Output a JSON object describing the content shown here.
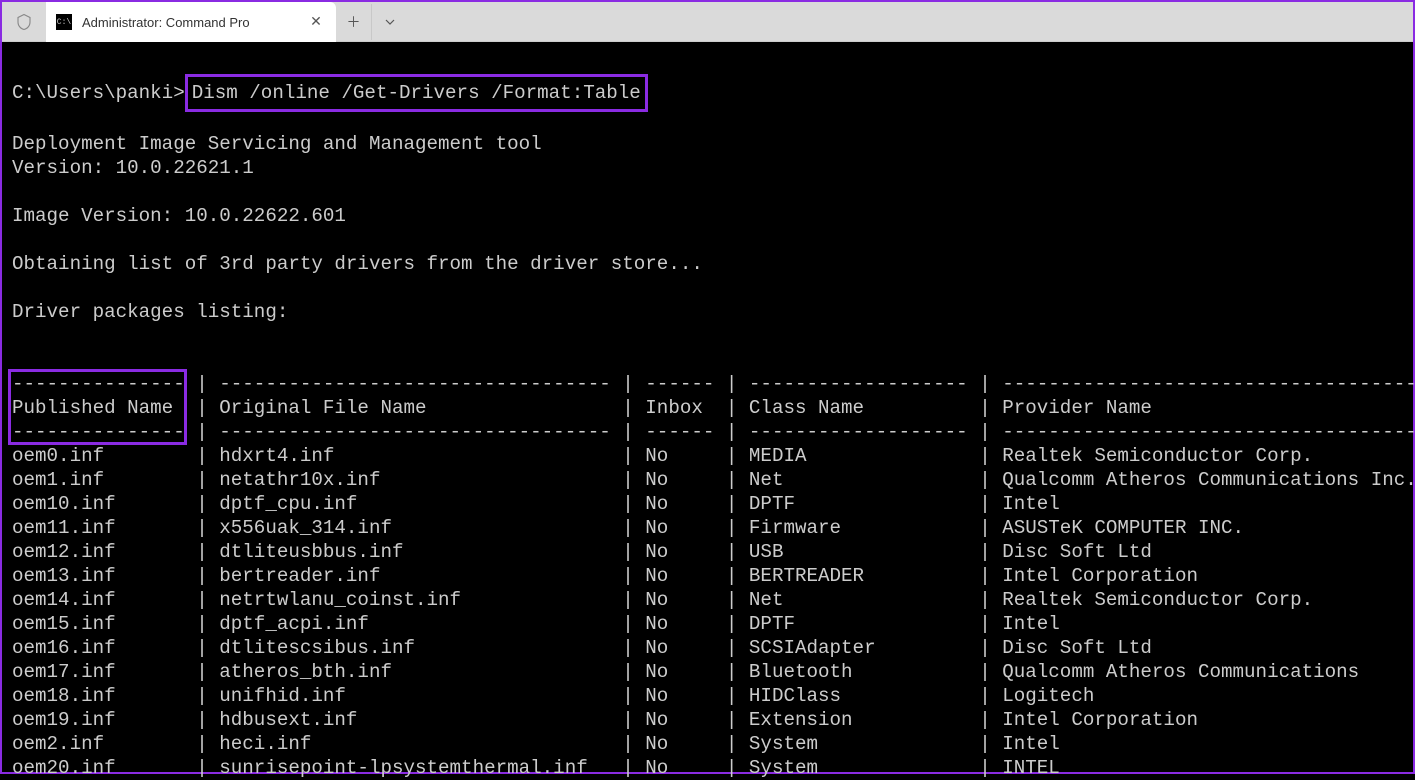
{
  "window": {
    "tab_title": "Administrator: Command Pro"
  },
  "terminal": {
    "prompt_path": "C:\\Users\\panki>",
    "command": "Dism /online /Get-Drivers /Format:Table",
    "tool_header": "Deployment Image Servicing and Management tool",
    "tool_version": "Version: 10.0.22621.1",
    "image_version": "Image Version: 10.0.22622.601",
    "obtaining": "Obtaining list of 3rd party drivers from the driver store...",
    "listing": "Driver packages listing:",
    "headers": {
      "published": "Published Name",
      "original": "Original File Name",
      "inbox": "Inbox",
      "class": "Class Name",
      "provider": "Provider Name"
    },
    "rows": [
      {
        "pub": "oem0.inf",
        "orig": "hdxrt4.inf",
        "inbox": "No",
        "class": "MEDIA",
        "prov": "Realtek Semiconductor Corp."
      },
      {
        "pub": "oem1.inf",
        "orig": "netathr10x.inf",
        "inbox": "No",
        "class": "Net",
        "prov": "Qualcomm Atheros Communications Inc."
      },
      {
        "pub": "oem10.inf",
        "orig": "dptf_cpu.inf",
        "inbox": "No",
        "class": "DPTF",
        "prov": "Intel"
      },
      {
        "pub": "oem11.inf",
        "orig": "x556uak_314.inf",
        "inbox": "No",
        "class": "Firmware",
        "prov": "ASUSTeK COMPUTER INC."
      },
      {
        "pub": "oem12.inf",
        "orig": "dtliteusbbus.inf",
        "inbox": "No",
        "class": "USB",
        "prov": "Disc Soft Ltd"
      },
      {
        "pub": "oem13.inf",
        "orig": "bertreader.inf",
        "inbox": "No",
        "class": "BERTREADER",
        "prov": "Intel Corporation"
      },
      {
        "pub": "oem14.inf",
        "orig": "netrtwlanu_coinst.inf",
        "inbox": "No",
        "class": "Net",
        "prov": "Realtek Semiconductor Corp."
      },
      {
        "pub": "oem15.inf",
        "orig": "dptf_acpi.inf",
        "inbox": "No",
        "class": "DPTF",
        "prov": "Intel"
      },
      {
        "pub": "oem16.inf",
        "orig": "dtlitescsibus.inf",
        "inbox": "No",
        "class": "SCSIAdapter",
        "prov": "Disc Soft Ltd"
      },
      {
        "pub": "oem17.inf",
        "orig": "atheros_bth.inf",
        "inbox": "No",
        "class": "Bluetooth",
        "prov": "Qualcomm Atheros Communications"
      },
      {
        "pub": "oem18.inf",
        "orig": "unifhid.inf",
        "inbox": "No",
        "class": "HIDClass",
        "prov": "Logitech"
      },
      {
        "pub": "oem19.inf",
        "orig": "hdbusext.inf",
        "inbox": "No",
        "class": "Extension",
        "prov": "Intel Corporation"
      },
      {
        "pub": "oem2.inf",
        "orig": "heci.inf",
        "inbox": "No",
        "class": "System",
        "prov": "Intel"
      },
      {
        "pub": "oem20.inf",
        "orig": "sunrisepoint-lpsystemthermal.inf",
        "inbox": "No",
        "class": "System",
        "prov": "INTEL"
      }
    ]
  }
}
